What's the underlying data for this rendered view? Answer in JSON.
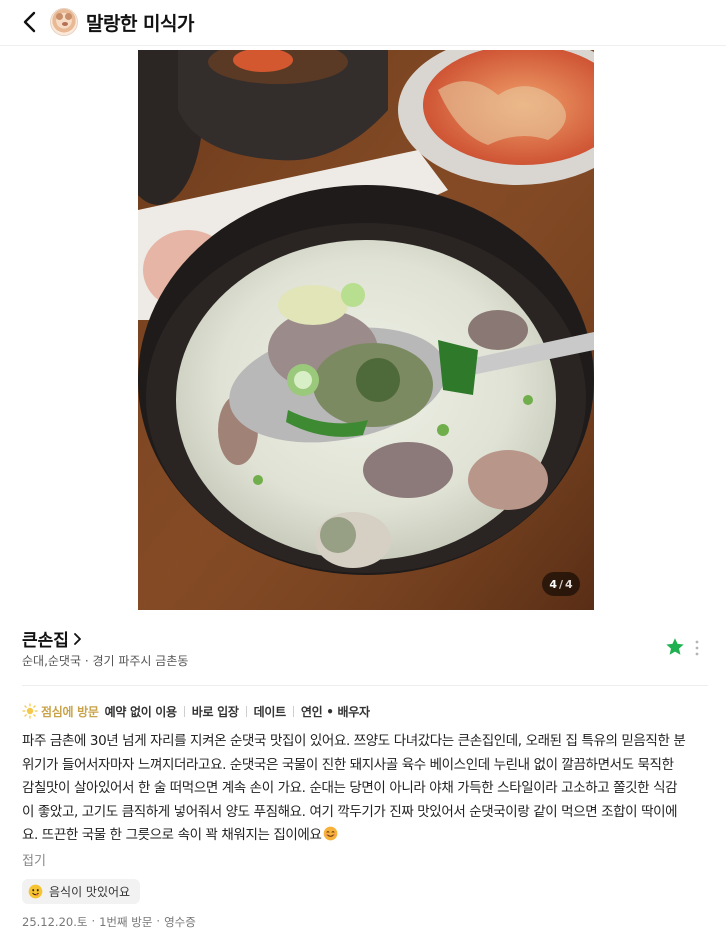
{
  "header": {
    "title": "말랑한 미식가",
    "back_icon": "chevron-left-icon",
    "avatar_icon": "hamster-avatar-icon"
  },
  "photo": {
    "current_page": "4",
    "separator": "/",
    "total_pages": "4"
  },
  "place": {
    "name": "큰손집",
    "meta": "순대,순댓국 · 경기 파주시 금촌동",
    "favorite_icon": "star-icon",
    "favorite_color": "#1fb14f",
    "more_icon": "more-vertical-icon"
  },
  "tags": {
    "highlight": "점심에 방문",
    "highlight_color": "#c9a34a",
    "items": [
      "예약 없이 이용",
      "바로 입장",
      "데이트",
      "연인 • 배우자"
    ]
  },
  "review": {
    "lines": [
      "파주 금촌에 30년 넘게 자리를 지켜온 순댓국 맛집이 있어요. 쯔양도 다녀갔다는 큰손집인데, 오래된 집 특유의 믿음직한 분",
      "위기가 들어서자마자 느껴지더라고요. 순댓국은 국물이 진한 돼지사골 육수 베이스인데 누린내 없이 깔끔하면서도 묵직한",
      "감칠맛이 살아있어서 한 술 떠먹으면 계속 손이 가요. 순대는 당면이 아니라 야채 가득한 스타일이라 고소하고 쫄깃한 식감",
      "이 좋았고, 고기도 큼직하게 넣어줘서 양도 푸짐해요. 여기 깍두기가 진짜 맛있어서 순댓국이랑 같이 먹으면 조합이 딱이에",
      "요. 뜨끈한 국물 한 그릇으로 속이 꽉 채워지는 집이에요"
    ],
    "fold_label": "접기"
  },
  "keyword": {
    "label": "음식이 맛있어요",
    "icon": "yummy-emoji-icon"
  },
  "footer": {
    "date": "25.12.20.토",
    "visit": "1번째 방문",
    "receipt": "영수증",
    "separator": "·"
  }
}
